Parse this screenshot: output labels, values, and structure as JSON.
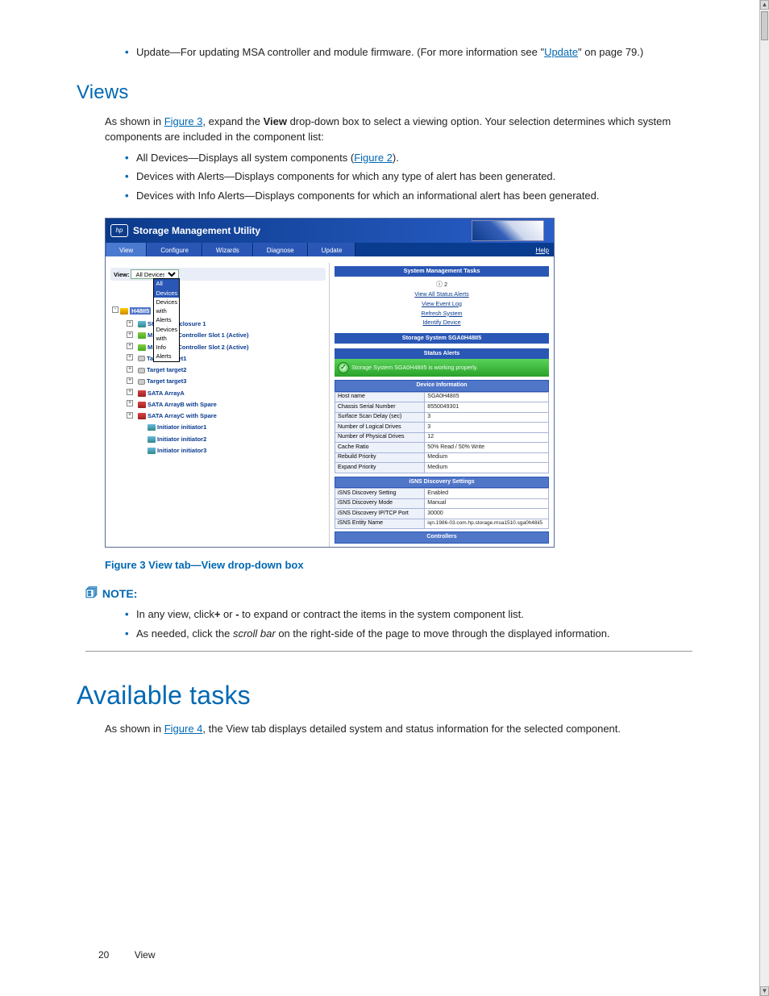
{
  "intro": {
    "bullet1_prefix": "Update—For updating MSA controller and module firmware.  (For more information see \"",
    "bullet1_link": "Update",
    "bullet1_suffix": "\" on page 79.)"
  },
  "views": {
    "heading": "Views",
    "para_prefix": "As shown in ",
    "para_link": "Figure 3",
    "para_mid": ", expand the ",
    "para_bold": "View",
    "para_suffix": " drop-down box to select a viewing option.  Your selection determines which system components are included in the component list:",
    "bullets": {
      "b1_prefix": "All Devices—Displays all system components (",
      "b1_link": "Figure 2",
      "b1_suffix": ").",
      "b2": "Devices with Alerts—Displays components for which any type of alert has been generated.",
      "b3": "Devices with Info Alerts—Displays components for which an informational alert has been generated."
    }
  },
  "figure": {
    "caption": "Figure 3 View tab—View drop-down box",
    "app_title": "Storage Management Utility",
    "menu": {
      "view": "View",
      "configure": "Configure",
      "wizards": "Wizards",
      "diagnose": "Diagnose",
      "update": "Update",
      "help": "Help"
    },
    "left": {
      "view_label": "View:",
      "selected": "All Devices",
      "options": [
        "All Devices",
        "Devices with Alerts",
        "Devices with Info Alerts"
      ],
      "root_suffix": "H48II5",
      "tree": {
        "enclosure": "Storage Enclosure 1",
        "ctrl1": "MSA1510i Controller Slot 1 (Active)",
        "ctrl2": "MSA1510i Controller Slot 2 (Active)",
        "target1": "Target target1",
        "target2": "Target target2",
        "target3": "Target target3",
        "arrA": "SATA ArrayA",
        "arrB": "SATA ArrayB with Spare",
        "arrC": "SATA ArrayC with Spare",
        "init1": "Initiator initiator1",
        "init2": "Initiator initiator2",
        "init3": "Initiator initiator3"
      }
    },
    "right": {
      "tasks_header": "System Management Tasks",
      "alerts_count": "2",
      "tasks": {
        "view_alerts": "View All Status Alerts",
        "view_log": "View Event Log",
        "refresh": "Refresh System",
        "identify": "Identify Device"
      },
      "system_header": "Storage System SGA0H48II5",
      "status_header": "Status Alerts",
      "status_msg": "Storage System SGA0H48II5 is working properly.",
      "device_info_header": "Device Information",
      "device_info": [
        [
          "Host name",
          "SGA0H48II5"
        ],
        [
          "Chassis Serial Number",
          "8550049301"
        ],
        [
          "Surface Scan Delay (sec)",
          "3"
        ],
        [
          "Number of Logical Drives",
          "3"
        ],
        [
          "Number of Physical Drives",
          "12"
        ],
        [
          "Cache Ratio",
          "50% Read / 50% Write"
        ],
        [
          "Rebuild Priority",
          "Medium"
        ],
        [
          "Expand Priority",
          "Medium"
        ]
      ],
      "isns_header": "iSNS Discovery Settings",
      "isns": [
        [
          "iSNS Discovery Setting",
          "Enabled"
        ],
        [
          "iSNS Discovery Mode",
          "Manual"
        ],
        [
          "iSNS Discovery IP/TCP Port",
          "30000"
        ],
        [
          "iSNS Entity Name",
          "iqn.1986-03.com.hp.storage.msa1510.sga0h48ii5"
        ]
      ],
      "controllers_header": "Controllers"
    }
  },
  "note": {
    "label": "NOTE:",
    "b1_prefix": "In any view, click",
    "b1_plus": "+",
    "b1_mid": " or ",
    "b1_minus": "-",
    "b1_suffix": " to expand or contract the items in the system component list.",
    "b2_prefix": "As needed, click the ",
    "b2_italic": "scroll bar",
    "b2_suffix": " on the right-side of the page to move through the displayed information."
  },
  "tasks": {
    "heading": "Available tasks",
    "para_prefix": "As shown in ",
    "para_link": "Figure 4",
    "para_suffix": ", the View tab displays detailed system and status information for the selected component."
  },
  "footer": {
    "page": "20",
    "section": "View"
  }
}
